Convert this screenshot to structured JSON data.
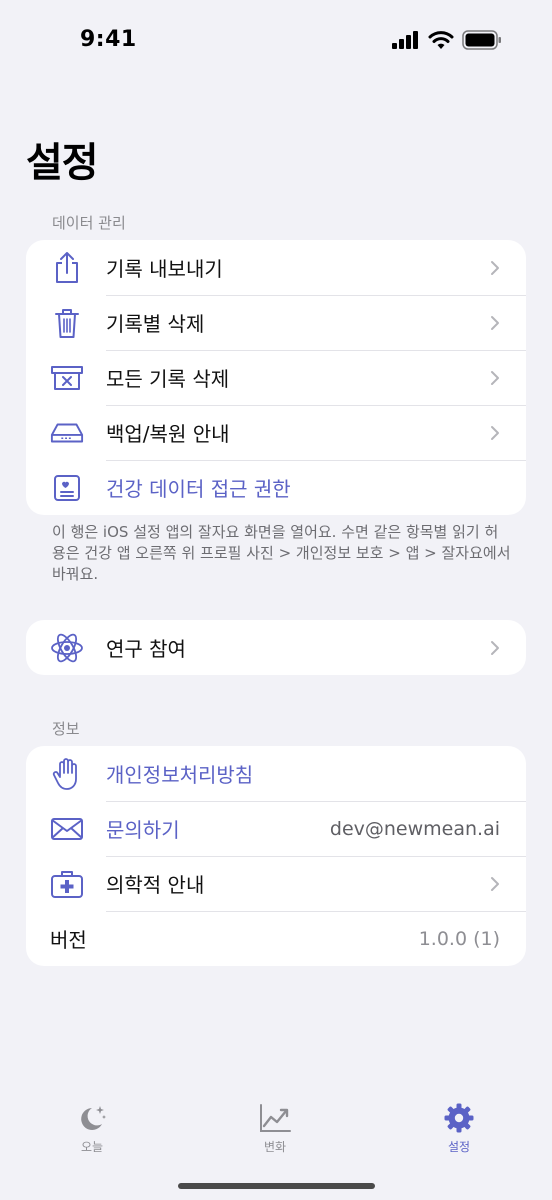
{
  "status_bar": {
    "time": "9:41"
  },
  "page": {
    "title": "설정"
  },
  "data_section": {
    "header": "데이터 관리",
    "items": [
      {
        "label": "기록 내보내기",
        "icon": "share-icon"
      },
      {
        "label": "기록별 삭제",
        "icon": "trash-icon"
      },
      {
        "label": "모든 기록 삭제",
        "icon": "trash-box-icon"
      },
      {
        "label": "백업/복원 안내",
        "icon": "drive-icon"
      },
      {
        "label": "건강 데이터 접근 권한",
        "icon": "health-card-icon"
      }
    ],
    "footnote": "이 행은 iOS 설정 앱의 잘자요 화면을 열어요. 수면 같은 항목별 읽기 허용은 건강 앱 오른쪽 위 프로필 사진 > 개인정보 보호 > 앱 > 잘자요에서 바꿔요."
  },
  "research_section": {
    "items": [
      {
        "label": "연구 참여",
        "icon": "atom-icon"
      }
    ]
  },
  "info_section": {
    "header": "정보",
    "items": [
      {
        "label": "개인정보처리방침",
        "icon": "hand-icon"
      },
      {
        "label": "문의하기",
        "icon": "envelope-icon",
        "value": "dev@newmean.ai"
      },
      {
        "label": "의학적 안내",
        "icon": "medical-kit-icon"
      },
      {
        "label": "버전",
        "value": "1.0.0 (1)"
      }
    ]
  },
  "tab_bar": {
    "tabs": [
      {
        "label": "오늘",
        "icon": "moon-stars-icon"
      },
      {
        "label": "변화",
        "icon": "chart-line-icon"
      },
      {
        "label": "설정",
        "icon": "gear-icon",
        "active": true
      }
    ]
  },
  "colors": {
    "accent": "#5b62c6",
    "background": "#f2f2f7",
    "card": "#ffffff",
    "secondary_text": "#8e8e93"
  }
}
